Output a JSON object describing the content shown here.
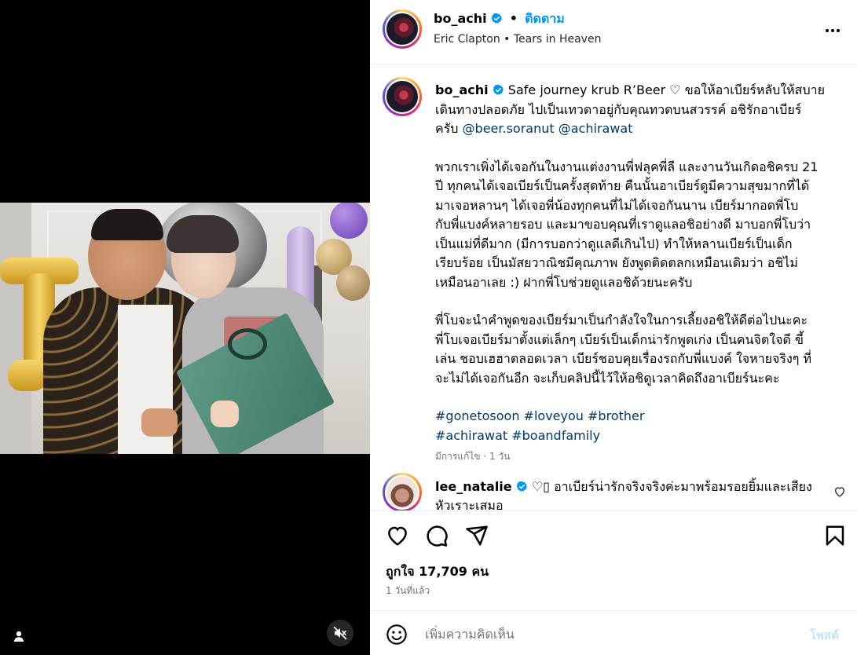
{
  "post": {
    "username": "bo_achi",
    "separator": "•",
    "follow_label": "ติดตาม",
    "audio": {
      "artist": "Eric Clapton",
      "dot": "•",
      "track": "Tears in Heaven"
    },
    "more_icon": "more-horizontal-icon"
  },
  "caption": {
    "username": "bo_achi",
    "line1": "Safe journey krub R’Beer ♡ ขอให้อาเบียร์หลับให้สบาย",
    "line2": "เดินทางปลอดภัย ไปเป็นเทวดาอยู่กับคุณทวดบนสวรรค์ อชิรักอาเบียร์",
    "line3_prefix": "ครับ",
    "mention1": "@beer.soranut",
    "mention2": "@achirawat",
    "para1": [
      "พวกเราเพิ่งได้เจอกันในงานแต่งงานพี่ฟลุคพี่ลี และงานวันเกิดอชิครบ 21",
      "ปี ทุกคนได้เจอเบียร์เป็นครั้งสุดท้าย คืนนั้นอาเบียร์ดูมีความสุขมากที่ได้",
      "มาเจอหลานๆ ได้เจอพี่น้องทุกคนที่ไม่ได้เจอกันนาน เบียร์มากอดพี่โบ",
      "กับพี่แบงค์หลายรอบ และมาขอบคุณที่เราดูแลอชิอย่างดี มาบอกพี่โบว่า",
      "เป็นแม่ที่ดีมาก (มีการบอกว่าดูแลดีเกินไป) ทำให้หลานเบียร์เป็นเด็ก",
      "เรียบร้อย เป็นมัสยวาณิชมีคุณภาพ ยังพูดติดตลกเหมือนเดิมว่า อชิไม่",
      "เหมือนอาเลย :) ฝากพี่โบช่วยดูแลอชิด้วยนะครับ"
    ],
    "para2": [
      "พี่โบจะนำคำพูดของเบียร์มาเป็นกำลังใจในการเลี้ยงอชิให้ดีต่อไปนะคะ",
      "พี่โบเจอเบียร์มาตั้งแต่เล็กๆ เบียร์เป็นเด็กน่ารักพูดเก่ง เป็นคนจิตใจดี ขี้",
      "เล่น ชอบเฮฮาตลอดเวลา เบียร์ชอบคุยเรื่องรถกับพี่แบงค์ ใจหายจริงๆ ที่",
      "จะไม่ได้เจอกันอีก จะเก็บคลิปนี้ไว้ให้อชิดูเวลาคิดถึงอาเบียร์นะคะ"
    ],
    "hashtags_line1": [
      "#gonetosoon",
      "#loveyou",
      "#brother"
    ],
    "hashtags_line2": [
      "#achirawat",
      "#boandfamily"
    ],
    "meta": "มีการแก้ไข · 1 วัน"
  },
  "comment": {
    "username": "lee_natalie",
    "text_line1": "♡▯ อาเบียร์น่ารักจริงจริงค่ะมาพร้อมรอยยิ้มและเสียง",
    "text_line2": "หัวเราะเสมอ",
    "like_icon": "heart-outline-icon"
  },
  "actions": {
    "icons": [
      "heart-icon",
      "comment-icon",
      "share-icon",
      "bookmark-icon"
    ],
    "likes_text": "ถูกใจ 17,709 คน",
    "time_text": "1 วันที่แล้ว"
  },
  "comment_input": {
    "emoji_icon": "emoji-icon",
    "placeholder": "เพิ่มความคิดเห็น",
    "post_label": "โพสต์"
  },
  "media": {
    "tag_icon": "user-tag-icon",
    "mute_icon": "muted-speaker-icon"
  },
  "colors": {
    "accent": "#0095f6",
    "link": "#00376b",
    "muted": "#737373",
    "post_disabled": "#c4e2fb",
    "verified": "#0095f6"
  }
}
